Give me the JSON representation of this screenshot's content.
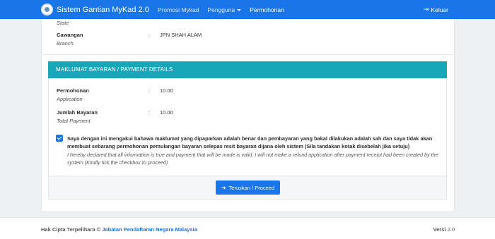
{
  "navbar": {
    "brand": "Sistem Gantian MyKad 2.0",
    "links": [
      {
        "label": "Promosi Mykad"
      },
      {
        "label": "Pengguna"
      },
      {
        "label": "Permohonan"
      }
    ],
    "logout": "Keluar",
    "colors": {
      "bar": "#1a75e8"
    }
  },
  "branch_section": {
    "state_sub": "State",
    "branch_label": "Cawangan",
    "branch_sub": "Branch",
    "branch_value": "JPN SHAH ALAM"
  },
  "payment": {
    "header": "MAKLUMAT BAYARAN / PAYMENT DETAILS",
    "header_color": "#17a7b8",
    "application_label": "Permohonan",
    "application_sub": "Application",
    "application_value": "10.00",
    "total_label": "Jumlah Bayaran",
    "total_sub": "Total Payment",
    "total_value": "10.00",
    "declaration_checked": true,
    "declaration_bold": "Saya dengan ini mengakui bahawa maklumat yang dipaparkan adalah benar dan pembayaran yang bakal dilakukan adalah sah dan saya tidak akan membuat sebarang permohonan pemulangan bayaran selepas resit bayaran dijana oleh sistem (Sila tandakan kotak disebelah jika setuju)",
    "declaration_italic": "I hereby declared that all information is true and payment that will be made is valid. I will not make a refund application after payment receipt had been created by the system (Kindly tick the checkbox to proceed)",
    "proceed_label": "Teruskan / Proceed"
  },
  "footer": {
    "copyright_prefix": "Hak Cipta Terpelihara ©",
    "copyright_link": "Jabatan Pendaftaran Negara Malaysia",
    "version_label": "Versi",
    "version_value": "2.0"
  }
}
